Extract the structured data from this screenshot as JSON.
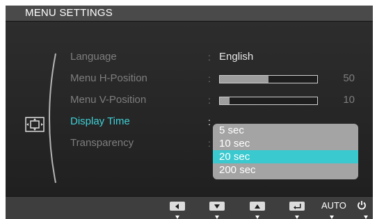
{
  "window": {
    "title": "MENU SETTINGS"
  },
  "menu": {
    "category_icon": "menu-settings-icon",
    "items": [
      {
        "label": "Language",
        "value": "English"
      },
      {
        "label": "Menu H-Position",
        "value": 50,
        "max": 100
      },
      {
        "label": "Menu V-Position",
        "value": 10,
        "max": 100
      },
      {
        "label": "Display Time"
      },
      {
        "label": "Transparency"
      }
    ],
    "colon": ":"
  },
  "dropdown": {
    "options": [
      "5 sec",
      "10 sec",
      "20 sec",
      "200 sec"
    ],
    "selected": "20 sec"
  },
  "bottom_bar": {
    "buttons": [
      {
        "name": "left-arrow-icon"
      },
      {
        "name": "down-arrow-icon"
      },
      {
        "name": "up-arrow-icon"
      },
      {
        "name": "enter-icon"
      },
      {
        "name": "auto-button",
        "label": "AUTO"
      },
      {
        "name": "power-icon"
      }
    ]
  },
  "colors": {
    "highlight": "#3ac9cf",
    "active_label": "#3fd0d6",
    "inactive_label": "#7e7e7e",
    "dropdown_bg": "#a4a4a4"
  }
}
